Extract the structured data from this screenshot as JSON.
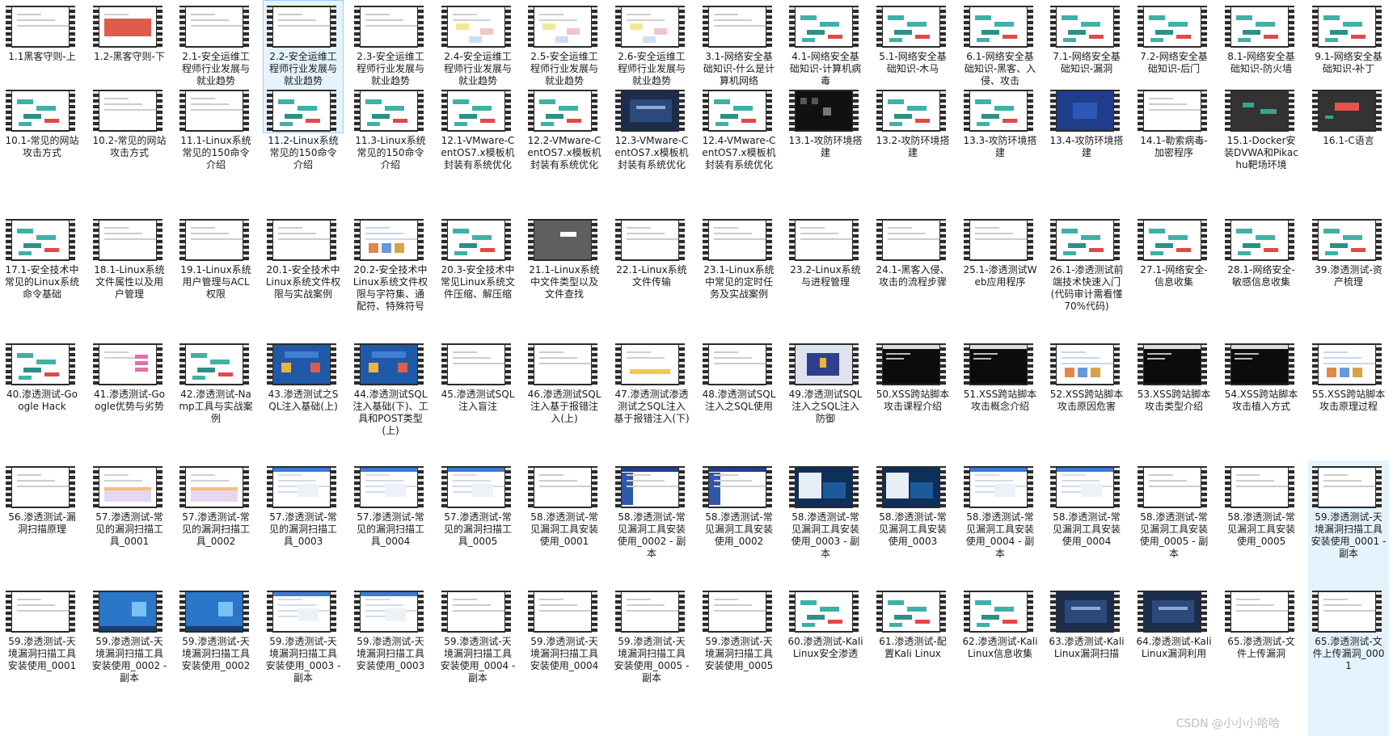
{
  "watermark": "CSDN @小小小哈哈",
  "videos": [
    {
      "label": "1.1黑客守则-上",
      "theme": "white"
    },
    {
      "label": "1.2-黑客守则-下",
      "theme": "red"
    },
    {
      "label": "2.1-安全运维工程师行业发展与就业趋势",
      "theme": "white"
    },
    {
      "label": "2.2-安全运维工程师行业发展与就业趋势",
      "theme": "white",
      "selected": true
    },
    {
      "label": "2.3-安全运维工程师行业发展与就业趋势",
      "theme": "white"
    },
    {
      "label": "2.4-安全运维工程师行业发展与就业趋势",
      "theme": "diagram"
    },
    {
      "label": "2.5-安全运维工程师行业发展与就业趋势",
      "theme": "diagram"
    },
    {
      "label": "2.6-安全运维工程师行业发展与就业趋势",
      "theme": "diagram"
    },
    {
      "label": "3.1-网络安全基础知识-什么是计算机网络",
      "theme": "white"
    },
    {
      "label": "4.1-网络安全基础知识-计算机病毒",
      "theme": "mindmap"
    },
    {
      "label": "5.1-网络安全基础知识-木马",
      "theme": "mindmap"
    },
    {
      "label": "6.1-网络安全基础知识-黑客、入侵、攻击",
      "theme": "mindmap"
    },
    {
      "label": "7.1-网络安全基础知识-漏洞",
      "theme": "mindmap"
    },
    {
      "label": "7.2-网络安全基础知识-后门",
      "theme": "mindmap"
    },
    {
      "label": "8.1-网络安全基础知识-防火墙",
      "theme": "mindmap"
    },
    {
      "label": "9.1-网络安全基础知识-补丁",
      "theme": "mindmap"
    },
    {
      "label": "10.1-常见的网站攻击方式",
      "theme": "mindmap"
    },
    {
      "label": "10.2-常见的网站攻击方式",
      "theme": "white"
    },
    {
      "label": "11.1-Linux系统常见的150命令介绍",
      "theme": "white"
    },
    {
      "label": "11.2-Linux系统常见的150命令介绍",
      "theme": "mindmap"
    },
    {
      "label": "11.3-Linux系统常见的150命令介绍",
      "theme": "mindmap"
    },
    {
      "label": "12.1-VMware-CentOS7.x模板机封装有系统优化",
      "theme": "mindmap"
    },
    {
      "label": "12.2-VMware-CentOS7.x模板机封装有系统优化",
      "theme": "mindmap"
    },
    {
      "label": "12.3-VMware-CentOS7.x模板机封装有系统优化",
      "theme": "vm"
    },
    {
      "label": "12.4-VMware-CentOS7.x模板机封装有系统优化",
      "theme": "mindmap"
    },
    {
      "label": "13.1-攻防环境搭建",
      "theme": "dark"
    },
    {
      "label": "13.2-攻防环境搭建",
      "theme": "mindmap"
    },
    {
      "label": "13.3-攻防环境搭建",
      "theme": "mindmap"
    },
    {
      "label": "13.4-攻防环境搭建",
      "theme": "blue"
    },
    {
      "label": "14.1-勒索病毒-加密程序",
      "theme": "white"
    },
    {
      "label": "15.1-Docker安装DVWA和Pikachu靶场环境",
      "theme": "darkgreen"
    },
    {
      "label": "16.1-C语言",
      "theme": "darkred"
    },
    {
      "label": "17.1-安全技术中常见的Linux系统命令基础",
      "theme": "mindmap"
    },
    {
      "label": "18.1-Linux系统文件属性以及用户管理",
      "theme": "white"
    },
    {
      "label": "19.1-Linux系统用户管理与ACL权限",
      "theme": "white"
    },
    {
      "label": "20.1-安全技术中Linux系统文件权限与实战案例",
      "theme": "white"
    },
    {
      "label": "20.2-安全技术中Linux系统文件权限与字符集、通配符、特殊符号",
      "theme": "web"
    },
    {
      "label": "20.3-安全技术中常见Linux系统文件压缩、解压缩",
      "theme": "mindmap"
    },
    {
      "label": "21.1-Linux系统中文件类型以及文件查找",
      "theme": "gray"
    },
    {
      "label": "22.1-Linux系统文件传输",
      "theme": "white"
    },
    {
      "label": "23.1-Linux系统中常见的定时任务及实战案例",
      "theme": "white"
    },
    {
      "label": "23.2-Linux系统与进程管理",
      "theme": "white"
    },
    {
      "label": "24.1-黑客入侵、攻击的流程步骤",
      "theme": "white"
    },
    {
      "label": "25.1-渗透测试Web应用程序",
      "theme": "white"
    },
    {
      "label": "26.1-渗透测试前端技术快速入门(代码审计需看懂70%代码)",
      "theme": "mindmap"
    },
    {
      "label": "27.1-网络安全-信息收集",
      "theme": "mindmap"
    },
    {
      "label": "28.1-网络安全-敏感信息收集",
      "theme": "mindmap"
    },
    {
      "label": "39.渗透测试-资产梳理",
      "theme": "mindmap"
    },
    {
      "label": "40.渗透测试-Google Hack",
      "theme": "mindmap"
    },
    {
      "label": "41.渗透测试-Google优势与劣势",
      "theme": "pink"
    },
    {
      "label": "42.渗透测试-Namp工具与实战案例",
      "theme": "mindmap"
    },
    {
      "label": "43.渗透测试之SQL注入基础(上)",
      "theme": "sql"
    },
    {
      "label": "44.渗透测试SQL注入基础(下)、工具和POST类型(上)",
      "theme": "sql"
    },
    {
      "label": "45.渗透测试SQL注入盲注",
      "theme": "white"
    },
    {
      "label": "46.渗透测试SQL注入基于报错注入(上)",
      "theme": "white"
    },
    {
      "label": "47.渗透测试渗透测试之SQL注入基于报错注入(下)",
      "theme": "yellow"
    },
    {
      "label": "48.渗透测试SQL注入之SQL使用",
      "theme": "white"
    },
    {
      "label": "49.渗透测试SQL注入之SQL注入防御",
      "theme": "shield"
    },
    {
      "label": "50.XSS跨站脚本攻击课程介绍",
      "theme": "terminal"
    },
    {
      "label": "51.XSS跨站脚本攻击概念介绍",
      "theme": "terminal"
    },
    {
      "label": "52.XSS跨站脚本攻击原因危害",
      "theme": "web"
    },
    {
      "label": "53.XSS跨站脚本攻击类型介绍",
      "theme": "terminal"
    },
    {
      "label": "54.XSS跨站脚本攻击植入方式",
      "theme": "terminal"
    },
    {
      "label": "55.XSS跨站脚本攻击原理过程",
      "theme": "web"
    },
    {
      "label": "56.渗透测试-漏洞扫描原理",
      "theme": "white"
    },
    {
      "label": "57.渗透测试-常见的漏洞扫描工具_0001",
      "theme": "table"
    },
    {
      "label": "57.渗透测试-常见的漏洞扫描工具_0002",
      "theme": "table"
    },
    {
      "label": "57.渗透测试-常见的漏洞扫描工具_0003",
      "theme": "win"
    },
    {
      "label": "57.渗透测试-常见的漏洞扫描工具_0004",
      "theme": "win"
    },
    {
      "label": "57.渗透测试-常见的漏洞扫描工具_0005",
      "theme": "win"
    },
    {
      "label": "58.渗透测试-常见漏洞工具安装使用_0001",
      "theme": "white"
    },
    {
      "label": "58.渗透测试-常见漏洞工具安装使用_0002 - 副本",
      "theme": "winblue"
    },
    {
      "label": "58.渗透测试-常见漏洞工具安装使用_0002",
      "theme": "winblue"
    },
    {
      "label": "58.渗透测试-常见漏洞工具安装使用_0003 - 副本",
      "theme": "splash"
    },
    {
      "label": "58.渗透测试-常见漏洞工具安装使用_0003",
      "theme": "splash"
    },
    {
      "label": "58.渗透测试-常见漏洞工具安装使用_0004 - 副本",
      "theme": "win"
    },
    {
      "label": "58.渗透测试-常见漏洞工具安装使用_0004",
      "theme": "win"
    },
    {
      "label": "58.渗透测试-常见漏洞工具安装使用_0005 - 副本",
      "theme": "white"
    },
    {
      "label": "58.渗透测试-常见漏洞工具安装使用_0005",
      "theme": "white"
    },
    {
      "label": "59.渗透测试-天境漏洞扫描工具安装使用_0001 - 副本",
      "theme": "white",
      "hover": true
    },
    {
      "label": "59.渗透测试-天境漏洞扫描工具安装使用_0001",
      "theme": "white"
    },
    {
      "label": "59.渗透测试-天境漏洞扫描工具安装使用_0002 - 副本",
      "theme": "win7"
    },
    {
      "label": "59.渗透测试-天境漏洞扫描工具安装使用_0002",
      "theme": "win7"
    },
    {
      "label": "59.渗透测试-天境漏洞扫描工具安装使用_0003 - 副本",
      "theme": "win"
    },
    {
      "label": "59.渗透测试-天境漏洞扫描工具安装使用_0003",
      "theme": "win"
    },
    {
      "label": "59.渗透测试-天境漏洞扫描工具安装使用_0004 - 副本",
      "theme": "white"
    },
    {
      "label": "59.渗透测试-天境漏洞扫描工具安装使用_0004",
      "theme": "white"
    },
    {
      "label": "59.渗透测试-天境漏洞扫描工具安装使用_0005 - 副本",
      "theme": "white"
    },
    {
      "label": "59.渗透测试-天境漏洞扫描工具安装使用_0005",
      "theme": "white"
    },
    {
      "label": "60.渗透测试-Kali Linux安全渗透",
      "theme": "mindmap"
    },
    {
      "label": "61.渗透测试-配置Kali Linux",
      "theme": "mindmap"
    },
    {
      "label": "62.渗透测试-Kali Linux信息收集",
      "theme": "mindmap"
    },
    {
      "label": "63.渗透测试-Kali Linux漏洞扫描",
      "theme": "vm"
    },
    {
      "label": "64.渗透测试-Kali Linux漏洞利用",
      "theme": "vm"
    },
    {
      "label": "65.渗透测试-文件上传漏洞",
      "theme": "white"
    },
    {
      "label": "65.渗透测试-文件上传漏洞_0001",
      "theme": "white",
      "hover": true
    }
  ]
}
